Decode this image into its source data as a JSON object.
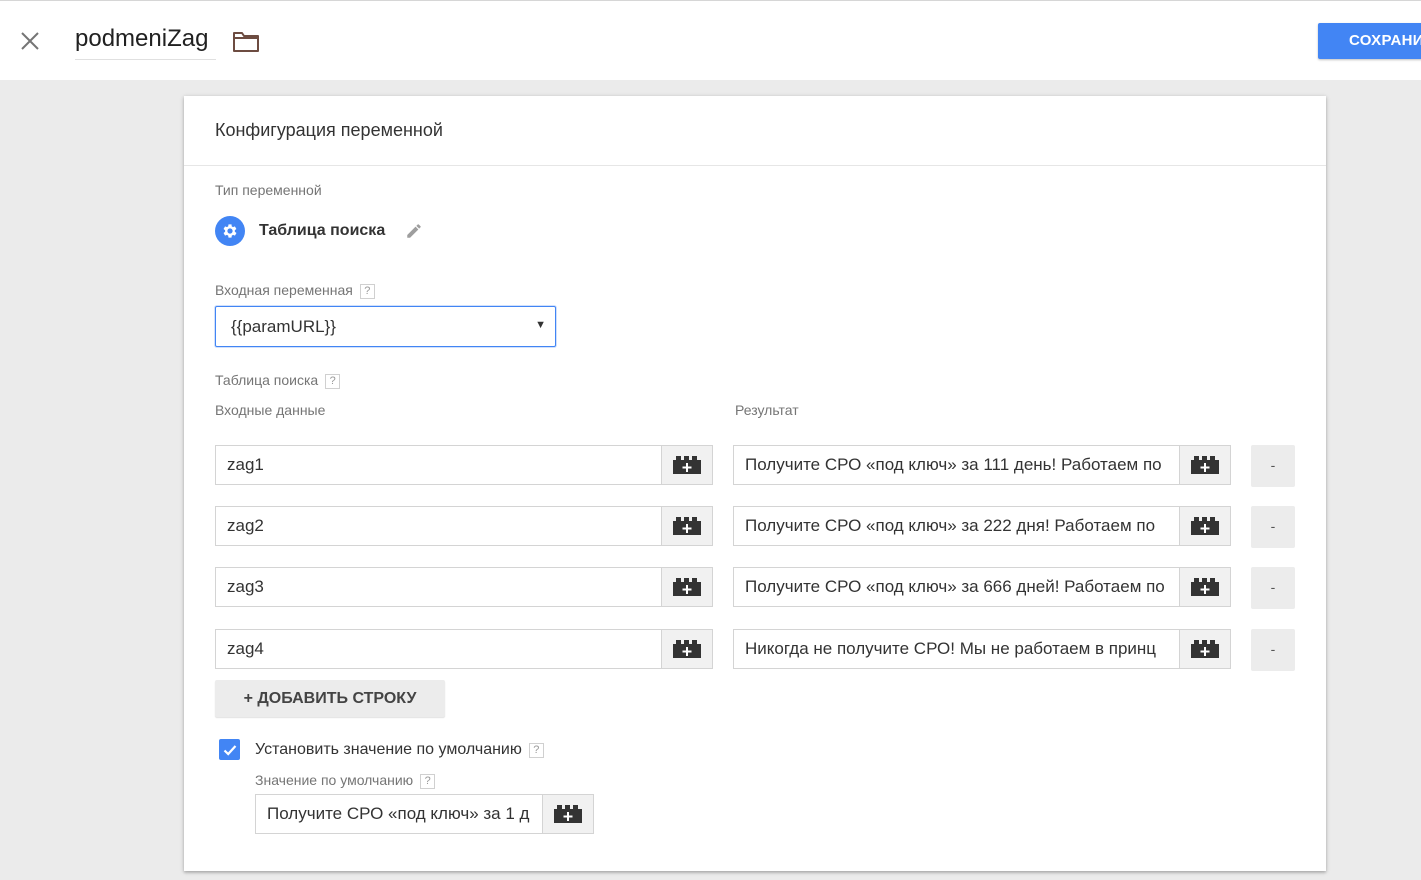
{
  "header": {
    "close_icon": "close-icon",
    "title": "podmeniZag",
    "folder_icon": "folder-icon",
    "save_label": "СОХРАНИТЬ",
    "accent": "#4285f4"
  },
  "config": {
    "heading": "Конфигурация переменной",
    "type_label": "Тип переменной",
    "type_icon": "gear-icon",
    "type_name": "Таблица поиска",
    "edit_icon": "pencil-icon",
    "input_var_label": "Входная переменная",
    "help_glyph": "?",
    "input_var_value": "{{paramURL}}",
    "lookup_label": "Таблица поиска",
    "col_input": "Входные данные",
    "col_output": "Результат",
    "rows": [
      {
        "input": "zag1",
        "output": "Получите СРО «под ключ» за 111 день! Работаем по"
      },
      {
        "input": "zag2",
        "output": "Получите СРО «под ключ» за 222 дня! Работаем по"
      },
      {
        "input": "zag3",
        "output": "Получите СРО «под ключ» за 666 дней! Работаем по"
      },
      {
        "input": "zag4",
        "output": "Никогда не получите СРО! Мы не работаем в принц"
      }
    ],
    "variable_button_icon": "brick-plus-icon",
    "remove_label": "-",
    "add_row_label": "+ ДОБАВИТЬ СТРОКУ",
    "default_checkbox_label": "Установить значение по умолчанию",
    "default_checked": true,
    "default_value_label": "Значение по умолчанию",
    "default_value": "Получите СРО «под ключ» за 1 д"
  }
}
